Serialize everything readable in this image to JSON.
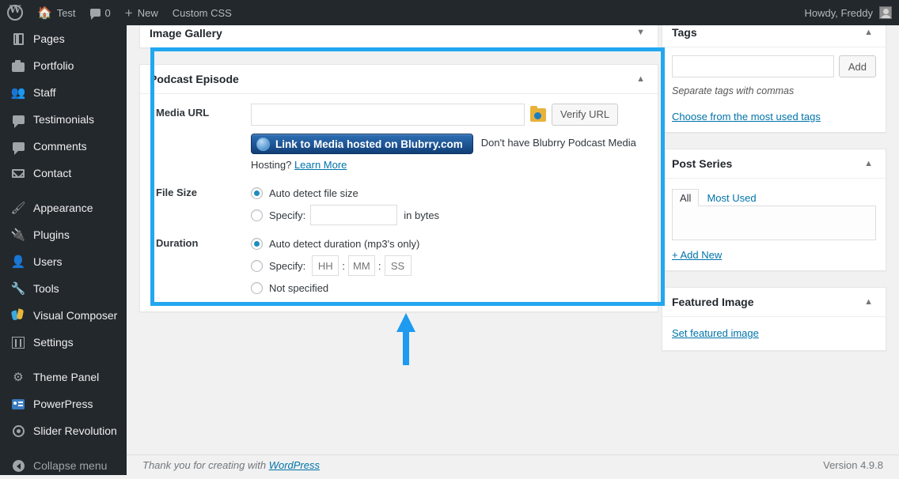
{
  "adminbar": {
    "wp_logo": "wordpress-logo",
    "site_name": "Test",
    "comments_count": "0",
    "new_label": "New",
    "custom_css_label": "Custom CSS",
    "howdy": "Howdy, Freddy"
  },
  "sidebar": {
    "items": [
      {
        "label": "Pages",
        "icon": "pages-icon"
      },
      {
        "label": "Portfolio",
        "icon": "portfolio-icon"
      },
      {
        "label": "Staff",
        "icon": "staff-icon"
      },
      {
        "label": "Testimonials",
        "icon": "testimonials-icon"
      },
      {
        "label": "Comments",
        "icon": "comments-icon"
      },
      {
        "label": "Contact",
        "icon": "contact-icon"
      },
      {
        "label": "Appearance",
        "icon": "appearance-icon"
      },
      {
        "label": "Plugins",
        "icon": "plugins-icon"
      },
      {
        "label": "Users",
        "icon": "users-icon"
      },
      {
        "label": "Tools",
        "icon": "tools-icon"
      },
      {
        "label": "Visual Composer",
        "icon": "visual-composer-icon"
      },
      {
        "label": "Settings",
        "icon": "settings-icon"
      },
      {
        "label": "Theme Panel",
        "icon": "gear-icon"
      },
      {
        "label": "PowerPress",
        "icon": "powerpress-icon"
      },
      {
        "label": "Slider Revolution",
        "icon": "slider-revolution-icon"
      },
      {
        "label": "Collapse menu",
        "icon": "collapse-icon"
      }
    ]
  },
  "main": {
    "image_gallery": {
      "title": "Image Gallery",
      "toggle": "▼"
    },
    "podcast_episode": {
      "title": "Podcast Episode",
      "toggle": "▲",
      "media_url_label": "Media URL",
      "media_url_value": "",
      "media_url_placeholder": "",
      "media_icon": "media-library-icon",
      "verify_button": "Verify URL",
      "blubrry_button": "Link to Media hosted on Blubrry.com",
      "blubrry_note": "Don't have Blubrry Podcast Media",
      "hosting_text": "Hosting?",
      "learn_more": "Learn More",
      "file_size_label": "File Size",
      "file_size_auto": "Auto detect file size",
      "file_size_specify": "Specify:",
      "file_size_value": "",
      "file_size_unit": "in bytes",
      "duration_label": "Duration",
      "duration_auto": "Auto detect duration (mp3's only)",
      "duration_specify": "Specify:",
      "duration_hh": "HH",
      "duration_mm": "MM",
      "duration_ss": "SS",
      "duration_colon": ":",
      "duration_not_specified": "Not specified"
    },
    "annotation": {
      "type": "arrow-up",
      "color": "#1e9bf0"
    }
  },
  "side": {
    "tags": {
      "title": "Tags",
      "toggle": "▲",
      "input_value": "",
      "add_button": "Add",
      "hint": "Separate tags with commas",
      "choose_link": "Choose from the most used tags"
    },
    "post_series": {
      "title": "Post Series",
      "toggle": "▲",
      "tab_all": "All",
      "tab_most_used": "Most Used",
      "add_new": "+ Add New"
    },
    "featured_image": {
      "title": "Featured Image",
      "toggle": "▲",
      "set_link": "Set featured image"
    }
  },
  "footer": {
    "thanks": "Thank you for creating with",
    "wordpress_link": "WordPress",
    "version": "Version 4.9.8"
  },
  "colors": {
    "admin_bg": "#23282d",
    "highlight": "#22a7f0",
    "link": "#0073aa",
    "accent_blue": "#1e8cbe"
  }
}
